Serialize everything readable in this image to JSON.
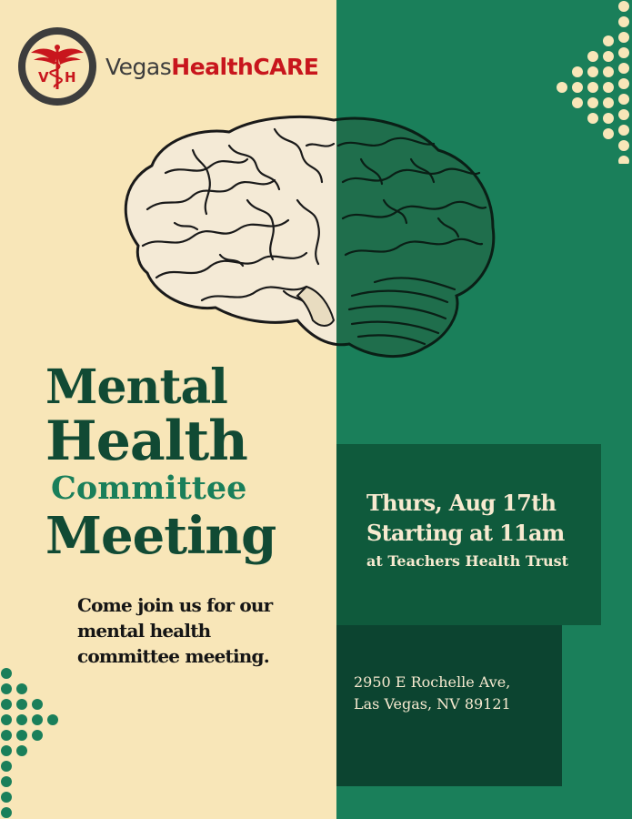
{
  "brand": {
    "logo_mark": "VH",
    "name_part1": "Vegas",
    "name_part2": "HealthCARE"
  },
  "title": {
    "line1": "Mental",
    "line2": "Health",
    "line3": "Committee",
    "line4": "Meeting"
  },
  "invite": "Come join us for our mental health committee meeting.",
  "event": {
    "date": "Thurs, Aug 17th",
    "time": "Starting at 11am",
    "venue": "at Teachers Health Trust"
  },
  "address": {
    "line1": "2950 E Rochelle Ave,",
    "line2": "Las Vegas, NV 89121"
  },
  "colors": {
    "cream": "#f8e6b8",
    "green": "#1a7f5a",
    "dark_green": "#0f5a3c",
    "darker_green": "#0c4430",
    "title_green": "#114a34",
    "brand_red": "#c8161d"
  },
  "icons": [
    "caduceus-icon",
    "brain-illustration",
    "dot-arrow-decoration"
  ]
}
